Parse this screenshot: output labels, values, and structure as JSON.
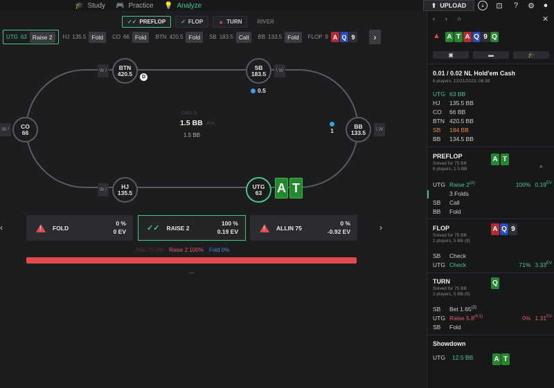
{
  "nav": {
    "study": "Study",
    "practice": "Practice",
    "analyze": "Analyze",
    "upload": "UPLOAD"
  },
  "streets": [
    {
      "label": "PREFLOP",
      "state": "active"
    },
    {
      "label": "FLOP",
      "state": "done"
    },
    {
      "label": "TURN",
      "state": "warn"
    },
    {
      "label": "RIVER",
      "state": "disabled"
    }
  ],
  "action_bar": {
    "utg": {
      "pos": "UTG",
      "stack": "63",
      "action": "Raise 2"
    },
    "hj": {
      "pos": "HJ",
      "stack": "135.5",
      "action": "Fold"
    },
    "co": {
      "pos": "CO",
      "stack": "66",
      "action": "Fold"
    },
    "btn": {
      "pos": "BTN",
      "stack": "420.5",
      "action": "Fold"
    },
    "sb": {
      "pos": "SB",
      "stack": "183.5",
      "action": "Call"
    },
    "bb": {
      "pos": "BB",
      "stack": "133.5",
      "action": "Fold"
    },
    "flop": {
      "label": "FLOP",
      "size": "9",
      "cards": [
        "A",
        "Q",
        "9"
      ]
    }
  },
  "table": {
    "seats": {
      "btn": {
        "pos": "BTN",
        "stack": "420.5"
      },
      "sb": {
        "pos": "SB",
        "stack": "183.5"
      },
      "co": {
        "pos": "CO",
        "stack": "66"
      },
      "bb": {
        "pos": "BB",
        "stack": "133.5"
      },
      "hj": {
        "pos": "HJ",
        "stack": "135.5"
      },
      "utg": {
        "pos": "UTG",
        "stack": "63"
      }
    },
    "w_badge": "W /",
    "w_badge_right": "\\ W",
    "dealer": "D",
    "sb_bet": "0.5",
    "bb_bet": "1",
    "pot_main": "1.5 BB",
    "pot_sub": "1.5 BB",
    "pot_ghost_top": "Call(1.5)",
    "pot_ghost_pct": "40%",
    "hero_cards": [
      "A",
      "T"
    ]
  },
  "choices": [
    {
      "label": "FOLD",
      "pct": "0 %",
      "ev": "0 EV"
    },
    {
      "label": "RAISE 2",
      "pct": "100 %",
      "ev": "0.19 EV"
    },
    {
      "label": "ALLIN 75",
      "pct": "0 %",
      "ev": "-0.92 EV"
    }
  ],
  "legend": {
    "allin": "Allin 75  0%",
    "raise": "Raise 2  100%",
    "fold": "Fold  0%"
  },
  "dots": "...",
  "panel": {
    "hand_cards": [
      "A",
      "T",
      "A",
      "Q",
      "9",
      "Q"
    ],
    "title": "0.01 / 0.02 NL Hold'em Cash",
    "subtitle": "6 players, 12/21/2023, 06:38",
    "players": [
      {
        "pos": "UTG",
        "stack": "63 BB"
      },
      {
        "pos": "HJ",
        "stack": "135.5 BB"
      },
      {
        "pos": "CO",
        "stack": "66 BB"
      },
      {
        "pos": "BTN",
        "stack": "420.5 BB"
      },
      {
        "pos": "SB",
        "stack": "184 BB"
      },
      {
        "pos": "BB",
        "stack": "134.5 BB"
      }
    ],
    "preflop": {
      "title": "PREFLOP",
      "line1": "Solved for 75 BB",
      "line2": "6 players, 1.5 BB",
      "cards": [
        "A",
        "T"
      ],
      "rows": [
        {
          "pos": "UTG",
          "action": "Raise 2",
          "extra": "(A)",
          "pct": "100%",
          "ev": "0.19",
          "ev_unit": "EV"
        },
        {
          "pos": "",
          "action": "3 Folds"
        },
        {
          "pos": "SB",
          "action": "Call"
        },
        {
          "pos": "BB",
          "action": "Fold"
        }
      ]
    },
    "flop": {
      "title": "FLOP",
      "line1": "Solved for 75 BB",
      "line2": "2 players, 5 BB (9)",
      "cards": [
        "A",
        "Q",
        "9"
      ],
      "rows": [
        {
          "pos": "SB",
          "action": "Check"
        },
        {
          "pos": "UTG",
          "action": "Check",
          "pct": "71%",
          "ev": "3.33",
          "ev_unit": "EV"
        }
      ]
    },
    "turn": {
      "title": "TURN",
      "line1": "Solved for 75 BB",
      "line2": "2 players, 5 BB (9)",
      "cards": [
        "Q"
      ],
      "rows": [
        {
          "pos": "SB",
          "action": "Bet 1.65",
          "extra": "(2)"
        },
        {
          "pos": "UTG",
          "action": "Raise 5.8",
          "extra": "(6.5)",
          "pct": "0%",
          "ev": "1.31",
          "ev_unit": "EV"
        },
        {
          "pos": "SB",
          "action": "Fold"
        }
      ]
    },
    "showdown": {
      "title": "Showdown",
      "pos": "UTG",
      "amount": "12.5 BB",
      "cards": [
        "A",
        "T"
      ]
    }
  },
  "colors": {
    "accent": "#49c78b",
    "danger": "#e24a4f",
    "club": "#24882f",
    "heart": "#b52a30",
    "diamond": "#2a4bb6",
    "spade": "#2f2f34"
  }
}
